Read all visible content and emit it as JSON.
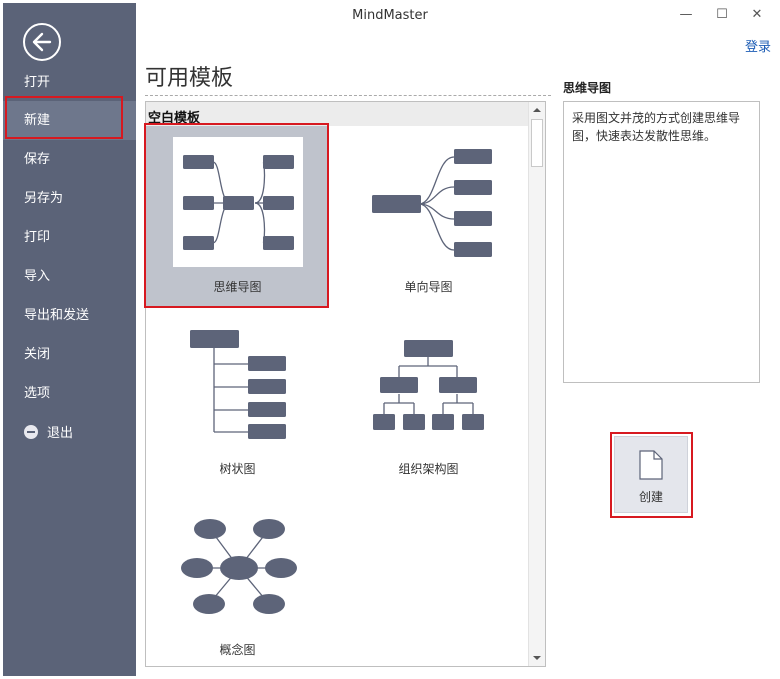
{
  "window": {
    "title": "MindMaster",
    "minimize": "—",
    "maximize": "☐",
    "close": "✕",
    "login": "登录"
  },
  "sidebar": {
    "items": [
      {
        "label": "打开"
      },
      {
        "label": "新建",
        "active": true
      },
      {
        "label": "保存"
      },
      {
        "label": "另存为"
      },
      {
        "label": "打印"
      },
      {
        "label": "导入"
      },
      {
        "label": "导出和发送"
      },
      {
        "label": "关闭"
      },
      {
        "label": "选项"
      },
      {
        "label": "退出",
        "icon": "exit-icon"
      }
    ]
  },
  "main": {
    "title": "可用模板",
    "group_label": "空白模板",
    "templates": [
      {
        "label": "思维导图",
        "icon": "mind-map-icon",
        "selected": true
      },
      {
        "label": "单向导图",
        "icon": "one-way-map-icon"
      },
      {
        "label": "树状图",
        "icon": "tree-chart-icon"
      },
      {
        "label": "组织架构图",
        "icon": "org-chart-icon"
      },
      {
        "label": "概念图",
        "icon": "concept-map-icon"
      }
    ]
  },
  "detail": {
    "title": "思维导图",
    "description": "采用图文并茂的方式创建思维导图，快速表达发散性思维。"
  },
  "create_button": {
    "label": "创建",
    "icon": "new-document-icon"
  },
  "colors": {
    "sidebar": "#5b6378",
    "node": "#5d6479",
    "highlight": "#d71920"
  }
}
